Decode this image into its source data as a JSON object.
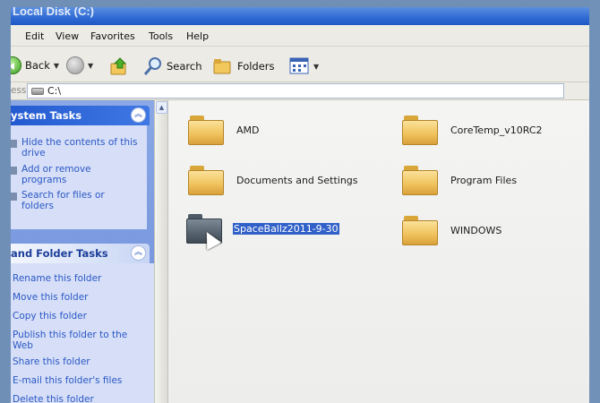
{
  "window": {
    "title": "Local Disk (C:)"
  },
  "menu": [
    "Edit",
    "View",
    "Favorites",
    "Tools",
    "Help"
  ],
  "toolbar": {
    "back_label": "Back",
    "search_label": "Search",
    "folders_label": "Folders"
  },
  "address": {
    "label": "ess",
    "path": "C:\\"
  },
  "system_tasks": {
    "title": "ystem Tasks",
    "items": [
      "Hide the contents of this drive",
      "Add or remove programs",
      "Search for files or folders"
    ]
  },
  "file_tasks": {
    "title": "and Folder Tasks",
    "items": [
      "Rename this folder",
      "Move this folder",
      "Copy this folder",
      "Publish this folder to the Web",
      "Share this folder",
      "E-mail this folder's files",
      "Delete this folder"
    ]
  },
  "folders": [
    {
      "name": "AMD",
      "selected": false
    },
    {
      "name": "CoreTemp_v10RC2",
      "selected": false
    },
    {
      "name": "Documents and Settings",
      "selected": false
    },
    {
      "name": "Program Files",
      "selected": false
    },
    {
      "name": "SpaceBallz2011-9-30",
      "selected": true
    },
    {
      "name": "WINDOWS",
      "selected": false
    }
  ],
  "colors": {
    "task_pane": "#6a8bd8",
    "selection": "#3160c9",
    "folder": "#f0c35e"
  }
}
